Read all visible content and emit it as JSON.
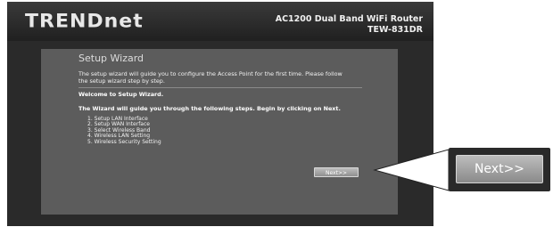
{
  "header": {
    "logo": "TRENDnet",
    "product_line1": "AC1200 Dual Band WiFi Router",
    "product_line2": "TEW-831DR"
  },
  "wizard": {
    "title": "Setup Wizard",
    "intro_line1": "The setup wizard will guide you to configure the Access Point for the first time. Please follow",
    "intro_line2": "the setup wizard step by step.",
    "welcome": "Welcome to Setup Wizard.",
    "guide": "The Wizard will guide you through the following steps. Begin by clicking on Next.",
    "steps": [
      "1. Setup LAN Interface",
      "2. Setup WAN Interface",
      "3. Select Wireless Band",
      "4. Wireless LAN Setting",
      "5. Wireless Security Setting"
    ],
    "next_label": "Next>>"
  },
  "callout": {
    "next_label": "Next>>"
  }
}
